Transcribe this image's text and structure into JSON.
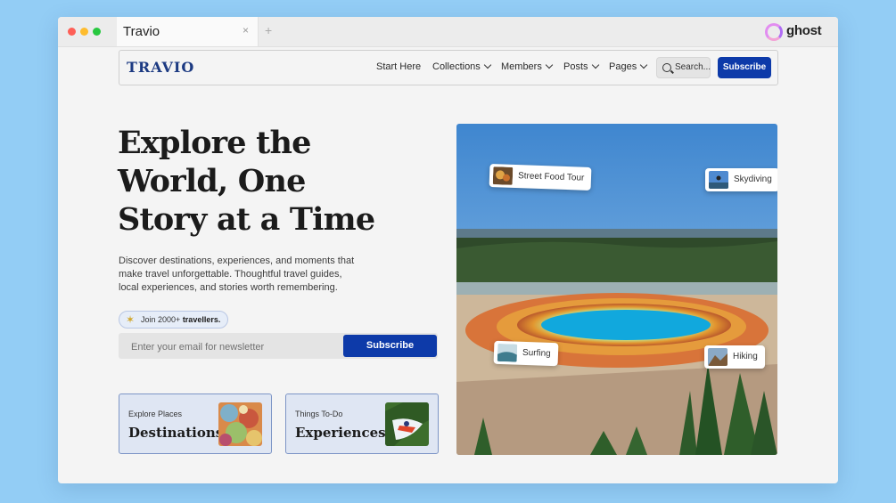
{
  "browser": {
    "tab_title": "Travio",
    "tab_close": "×",
    "tab_new": "+",
    "brand_logo": "ghost"
  },
  "nav": {
    "brand": "TRAVIO",
    "items": [
      {
        "label": "Start Here",
        "has_dropdown": false
      },
      {
        "label": "Collections",
        "has_dropdown": true
      },
      {
        "label": "Members",
        "has_dropdown": true
      },
      {
        "label": "Posts",
        "has_dropdown": true
      },
      {
        "label": "Pages",
        "has_dropdown": true
      }
    ],
    "search_label": "Search...",
    "subscribe_label": "Subscribe"
  },
  "hero": {
    "title": "Explore the World, One Story at a Time",
    "description": "Discover destinations, experiences, and moments that make travel unforgettable. Thoughtful travel guides, local experiences, and stories worth remembering.",
    "join_prefix": "Join 2000+",
    "join_bold": "travellers.",
    "newsletter_placeholder": "Enter your email for newsletter",
    "newsletter_button": "Subscribe"
  },
  "cards": [
    {
      "kicker": "Explore Places",
      "title": "Destinations"
    },
    {
      "kicker": "Things To-Do",
      "title": "Experiences"
    }
  ],
  "chips": {
    "street_food": "Street Food Tour",
    "skydiving": "Skydiving",
    "surfing": "Surfing",
    "hiking": "Hiking"
  },
  "colors": {
    "accent": "#0d3aa9",
    "brand_text": "#1c3a82",
    "page_bg": "#93cdf5"
  }
}
